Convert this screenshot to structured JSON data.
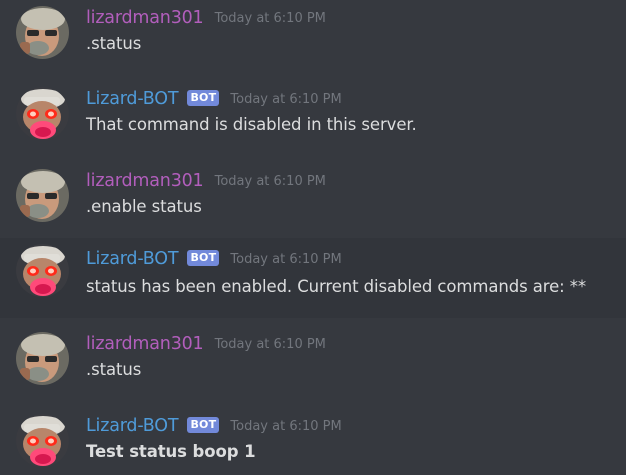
{
  "colors": {
    "background": "#36393f",
    "hover_background": "#32353b",
    "user_name_color": "#b25ebc",
    "bot_name_color": "#4f9bd9",
    "bot_badge_color": "#7289da",
    "timestamp_color": "#72767d",
    "text_color": "#dcddde"
  },
  "messages": [
    {
      "author": "lizardman301",
      "is_bot": false,
      "timestamp": "Today at 6:10 PM",
      "text": ".status",
      "bold": false,
      "avatar": "lizardman-avatar"
    },
    {
      "author": "Lizard-BOT",
      "is_bot": true,
      "badge": "BOT",
      "timestamp": "Today at 6:10 PM",
      "text": "That command is disabled in this server.",
      "bold": false,
      "avatar": "lizard-bot-avatar"
    },
    {
      "author": "lizardman301",
      "is_bot": false,
      "timestamp": "Today at 6:10 PM",
      "text": ".enable status",
      "bold": false,
      "avatar": "lizardman-avatar"
    },
    {
      "author": "Lizard-BOT",
      "is_bot": true,
      "badge": "BOT",
      "timestamp": "Today at 6:10 PM",
      "text": "status has been enabled. Current disabled commands are:  **",
      "bold": false,
      "avatar": "lizard-bot-avatar"
    },
    {
      "author": "lizardman301",
      "is_bot": false,
      "timestamp": "Today at 6:10 PM",
      "text": ".status",
      "bold": false,
      "avatar": "lizardman-avatar"
    },
    {
      "author": "Lizard-BOT",
      "is_bot": true,
      "badge": "BOT",
      "timestamp": "Today at 6:10 PM",
      "text": "Test status boop 1",
      "bold": true,
      "avatar": "lizard-bot-avatar"
    }
  ]
}
